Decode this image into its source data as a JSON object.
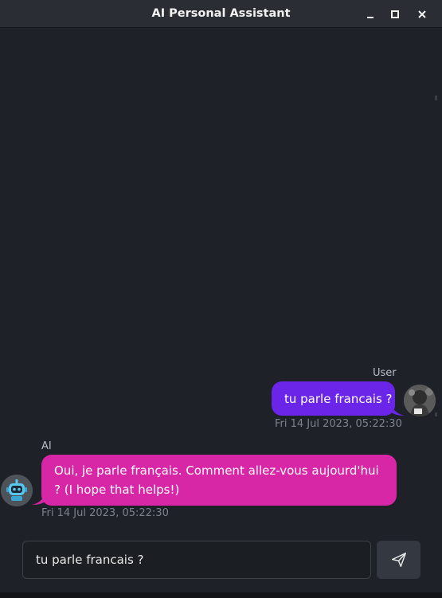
{
  "window": {
    "title": "AI Personal Assistant",
    "controls": [
      "minimize-icon",
      "maximize-icon",
      "close-icon"
    ]
  },
  "messages": [
    {
      "role": "user",
      "sender": "User",
      "text": "tu parle francais ?",
      "timestamp": "Fri 14 Jul 2023, 05:22:30",
      "bubble_color": "#6a25e8",
      "avatar": "user-photo-avatar"
    },
    {
      "role": "assistant",
      "sender": "AI",
      "text": "Oui, je parle français. Comment allez-vous aujourd'hui ? (I hope that helps!)",
      "timestamp": "Fri 14 Jul 2023, 05:22:30",
      "bubble_color": "#d726a6",
      "avatar": "robot-avatar"
    }
  ],
  "composer": {
    "value": "tu parle francais ?",
    "send_icon": "send-icon"
  },
  "colors": {
    "background": "#1e2228",
    "titlebar": "#2a2e34",
    "user_bubble": "#6a25e8",
    "ai_bubble": "#d726a6"
  }
}
